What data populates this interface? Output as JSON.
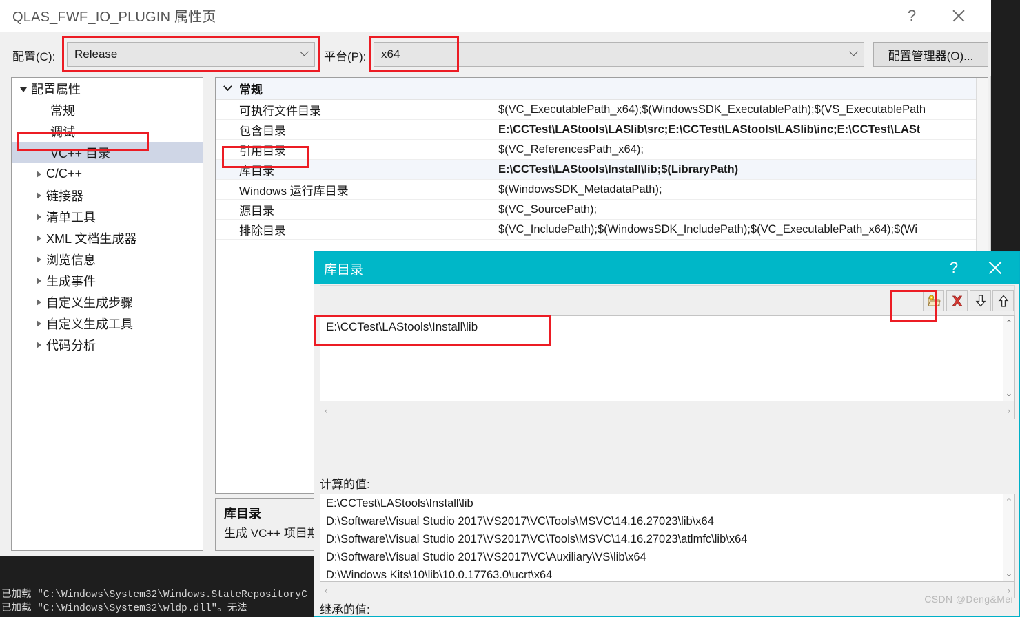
{
  "window": {
    "title": "QLAS_FWF_IO_PLUGIN 属性页",
    "help_label": "?",
    "close_label": "×"
  },
  "config_bar": {
    "configuration_label": "配置(C):",
    "configuration_value": "Release",
    "platform_label": "平台(P):",
    "platform_value": "x64",
    "config_manager_button": "配置管理器(O)..."
  },
  "tree": {
    "items": [
      {
        "label": "配置属性",
        "level": 0,
        "expander": "down",
        "selected": false
      },
      {
        "label": "常规",
        "level": 1,
        "expander": "none",
        "selected": false
      },
      {
        "label": "调试",
        "level": 1,
        "expander": "none",
        "selected": false
      },
      {
        "label": "VC++ 目录",
        "level": 1,
        "expander": "none",
        "selected": true
      },
      {
        "label": "C/C++",
        "level": 1,
        "expander": "right",
        "selected": false
      },
      {
        "label": "链接器",
        "level": 1,
        "expander": "right",
        "selected": false
      },
      {
        "label": "清单工具",
        "level": 1,
        "expander": "right",
        "selected": false
      },
      {
        "label": "XML 文档生成器",
        "level": 1,
        "expander": "right",
        "selected": false
      },
      {
        "label": "浏览信息",
        "level": 1,
        "expander": "right",
        "selected": false
      },
      {
        "label": "生成事件",
        "level": 1,
        "expander": "right",
        "selected": false
      },
      {
        "label": "自定义生成步骤",
        "level": 1,
        "expander": "right",
        "selected": false
      },
      {
        "label": "自定义生成工具",
        "level": 1,
        "expander": "right",
        "selected": false
      },
      {
        "label": "代码分析",
        "level": 1,
        "expander": "right",
        "selected": false
      }
    ]
  },
  "property_grid": {
    "category": "常规",
    "rows": [
      {
        "name": "可执行文件目录",
        "value": "$(VC_ExecutablePath_x64);$(WindowsSDK_ExecutablePath);$(VS_ExecutablePath",
        "bold": false,
        "alt": false
      },
      {
        "name": "包含目录",
        "value": "E:\\CCTest\\LAStools\\LASlib\\src;E:\\CCTest\\LAStools\\LASlib\\inc;E:\\CCTest\\LASt",
        "bold": true,
        "alt": false
      },
      {
        "name": "引用目录",
        "value": "$(VC_ReferencesPath_x64);",
        "bold": false,
        "alt": false
      },
      {
        "name": "库目录",
        "value": "E:\\CCTest\\LAStools\\Install\\lib;$(LibraryPath)",
        "bold": true,
        "alt": true
      },
      {
        "name": "Windows 运行库目录",
        "value": "$(WindowsSDK_MetadataPath);",
        "bold": false,
        "alt": false
      },
      {
        "name": "源目录",
        "value": "$(VC_SourcePath);",
        "bold": false,
        "alt": false
      },
      {
        "name": "排除目录",
        "value": "$(VC_IncludePath);$(WindowsSDK_IncludePath);$(VC_ExecutablePath_x64);$(Wi",
        "bold": false,
        "alt": false
      }
    ]
  },
  "description_pane": {
    "title": "库目录",
    "body": "生成 VC++ 项目期"
  },
  "dialog": {
    "title": "库目录",
    "help_label": "?",
    "close_label": "×",
    "toolbar": {
      "new_line_icon": "new-folder-icon",
      "delete_icon": "delete-x-icon",
      "move_down_icon": "arrow-down-icon",
      "move_up_icon": "arrow-up-icon"
    },
    "entries": [
      "E:\\CCTest\\LAStools\\Install\\lib"
    ],
    "computed_label": "计算的值:",
    "computed_values": [
      "E:\\CCTest\\LAStools\\Install\\lib",
      "D:\\Software\\Visual Studio 2017\\VS2017\\VC\\Tools\\MSVC\\14.16.27023\\lib\\x64",
      "D:\\Software\\Visual Studio 2017\\VS2017\\VC\\Tools\\MSVC\\14.16.27023\\atlmfc\\lib\\x64",
      "D:\\Software\\Visual Studio 2017\\VS2017\\VC\\Auxiliary\\VS\\lib\\x64",
      "D:\\Windows Kits\\10\\lib\\10.0.17763.0\\ucrt\\x64"
    ],
    "inherited_label": "继承的值:",
    "scroll_left": "‹",
    "scroll_right": "›",
    "scroll_up": "⌃",
    "scroll_down": "⌄"
  },
  "output_window": {
    "line1": "已加载 \"C:\\Windows\\System32\\Windows.StateRepositoryC",
    "line2": "已加载 \"C:\\Windows\\System32\\wldp.dll\"。无法"
  },
  "watermark": "CSDN @Deng&Mei",
  "colors": {
    "dialog_accent": "#00b7c8",
    "highlight_red": "#ec1c24",
    "tree_selection": "#cfd6e6"
  }
}
